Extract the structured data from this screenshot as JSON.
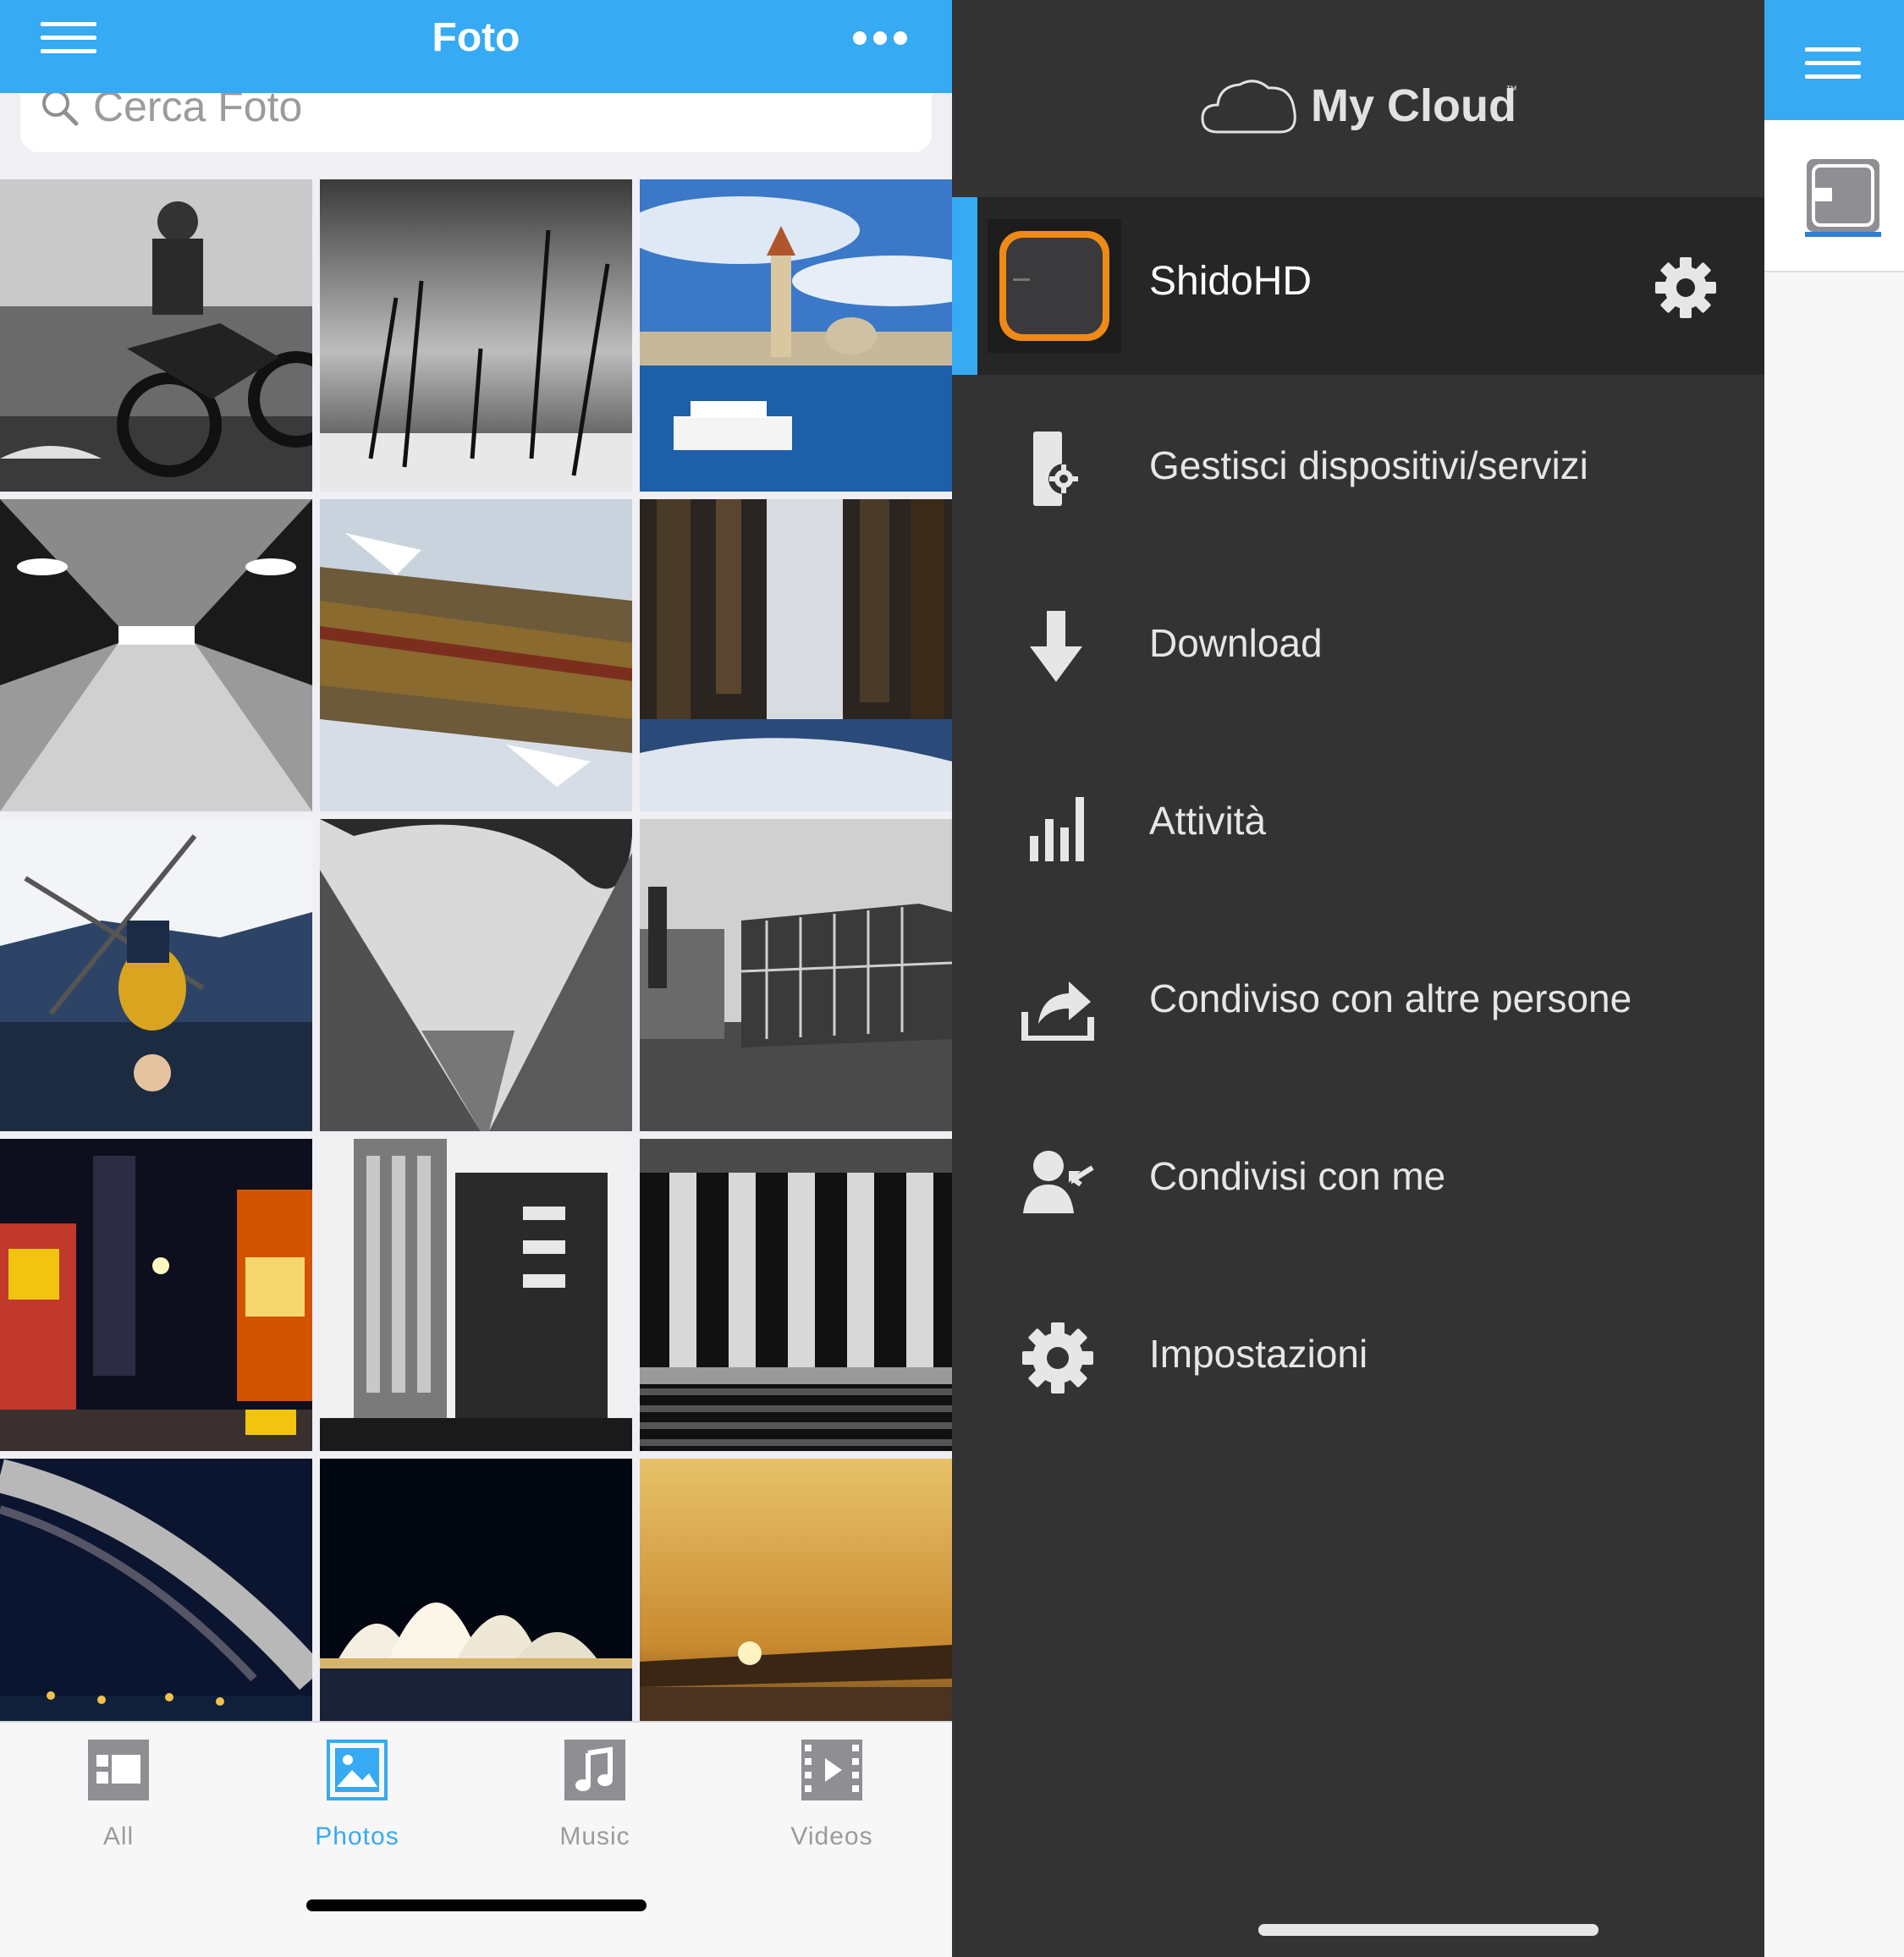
{
  "left_app": {
    "title": "Foto",
    "search_placeholder": "Cerca Foto",
    "tabs": [
      {
        "label": "All",
        "icon": "all-icon",
        "active": false
      },
      {
        "label": "Photos",
        "icon": "photos-icon",
        "active": true
      },
      {
        "label": "Music",
        "icon": "music-icon",
        "active": false
      },
      {
        "label": "Videos",
        "icon": "videos-icon",
        "active": false
      }
    ]
  },
  "drawer": {
    "brand": "My Cloud",
    "trademark": "™",
    "device": {
      "name": "ShidoHD"
    },
    "menu": [
      {
        "label": "Gestisci dispositivi/servizi",
        "icon": "manage-devices-icon"
      },
      {
        "label": "Download",
        "icon": "download-icon"
      },
      {
        "label": "Attività",
        "icon": "activity-icon"
      },
      {
        "label": "Condiviso con altre persone",
        "icon": "share-icon"
      },
      {
        "label": "Condivisi con me",
        "icon": "shared-with-me-icon"
      },
      {
        "label": "Impostazioni",
        "icon": "settings-icon"
      }
    ]
  },
  "colors": {
    "accent": "#36aaf3",
    "drawer_background": "#333333",
    "device_row_background": "#262626"
  }
}
